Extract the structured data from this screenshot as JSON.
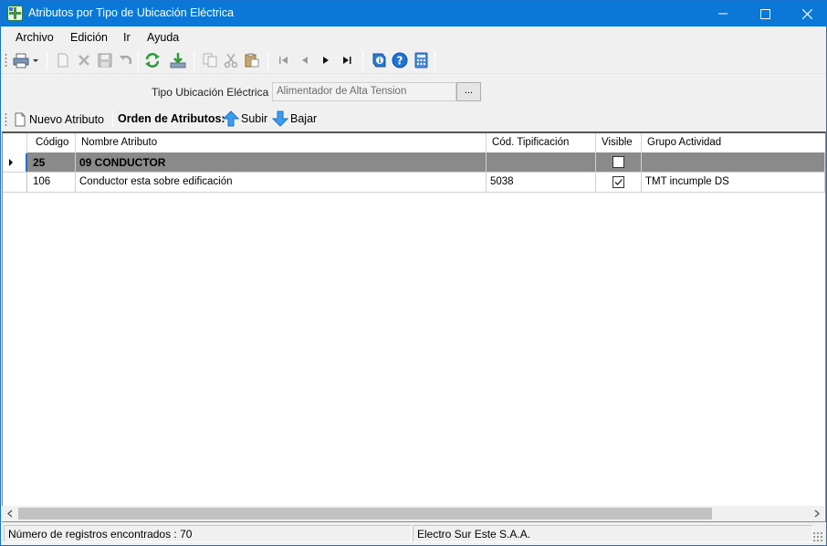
{
  "window": {
    "title": "Atributos por Tipo de Ubicación Eléctrica",
    "accent_color": "#0b78d7"
  },
  "menu": {
    "items": [
      "Archivo",
      "Edición",
      "Ir",
      "Ayuda"
    ]
  },
  "toolbar": {
    "buttons": [
      {
        "icon": "print-icon",
        "enabled": true
      },
      {
        "icon": "new-document-icon",
        "enabled": false
      },
      {
        "icon": "delete-icon",
        "enabled": false
      },
      {
        "icon": "save-icon",
        "enabled": false
      },
      {
        "icon": "undo-icon",
        "enabled": false
      },
      {
        "icon": "refresh-icon",
        "enabled": true
      },
      {
        "icon": "download-icon",
        "enabled": true
      },
      {
        "icon": "copy-icon",
        "enabled": false
      },
      {
        "icon": "cut-icon",
        "enabled": false
      },
      {
        "icon": "paste-icon",
        "enabled": false
      },
      {
        "icon": "first-record-icon",
        "enabled": false
      },
      {
        "icon": "previous-record-icon",
        "enabled": false
      },
      {
        "icon": "next-record-icon",
        "enabled": true
      },
      {
        "icon": "last-record-icon",
        "enabled": true
      },
      {
        "icon": "info-book-icon",
        "enabled": true
      },
      {
        "icon": "help-icon",
        "enabled": true
      },
      {
        "icon": "calculator-icon",
        "enabled": true
      }
    ]
  },
  "filter": {
    "label": "Tipo Ubicación Eléctrica :",
    "value": "Alimentador de Alta Tension",
    "browse_label": "..."
  },
  "attr_toolbar": {
    "new_label": "Nuevo Atributo",
    "order_label": "Orden de Atributos:",
    "up_label": "Subir",
    "down_label": "Bajar"
  },
  "grid": {
    "columns": [
      "Código",
      "Nombre Atributo",
      "Cód. Tipificación",
      "Visible",
      "Grupo Actividad"
    ],
    "group_row": {
      "code": "25",
      "name": "09 CONDUCTOR",
      "tip": "",
      "visible": false,
      "group": ""
    },
    "rows": [
      {
        "code": "106",
        "name": "Conductor esta sobre edificación",
        "tip": "5038",
        "visible": true,
        "group": "TMT incumple DS"
      }
    ]
  },
  "status": {
    "records": "Número de registros encontrados : 70",
    "company": "Electro Sur Este S.A.A."
  }
}
